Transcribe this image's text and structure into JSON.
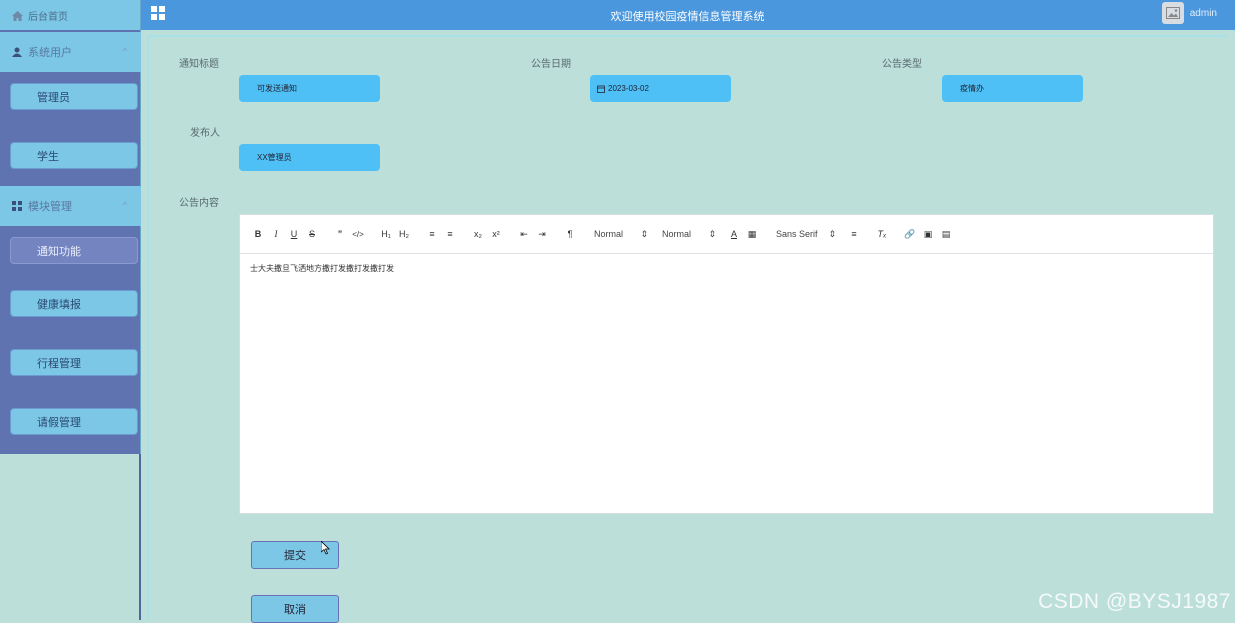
{
  "header": {
    "home_label": "后台首页",
    "title": "欢迎使用校园疫情信息管理系统",
    "username": "admin"
  },
  "sidebar": {
    "groups": [
      {
        "label": "系统用户",
        "icon": "user-icon",
        "items": [
          "管理员",
          "学生"
        ]
      },
      {
        "label": "模块管理",
        "icon": "grid-icon",
        "items": [
          "通知功能",
          "健康填报",
          "行程管理",
          "请假管理"
        ]
      }
    ],
    "active_item": "通知功能"
  },
  "form": {
    "title_label": "通知标题",
    "title_value": "可发送通知",
    "date_label": "公告日期",
    "date_value": "2023-03-02",
    "type_label": "公告类型",
    "type_value": "疫情办",
    "publisher_label": "发布人",
    "publisher_value": "XX管理员",
    "content_label": "公告内容",
    "content_text": "士大夫撒旦飞洒地方撒打发撒打发撒打发",
    "toolbar": {
      "header_select": "Normal",
      "size_select": "Normal",
      "font_select": "Sans Serif"
    },
    "submit_label": "提交",
    "cancel_label": "取消"
  },
  "watermark": "CSDN @BYSJ1987",
  "colors": {
    "topbar": "#4a97de",
    "sidebar": "#5f73b0",
    "accent": "#7cc6e6",
    "field": "#4ec0f6",
    "main_bg": "#bcdfda"
  }
}
